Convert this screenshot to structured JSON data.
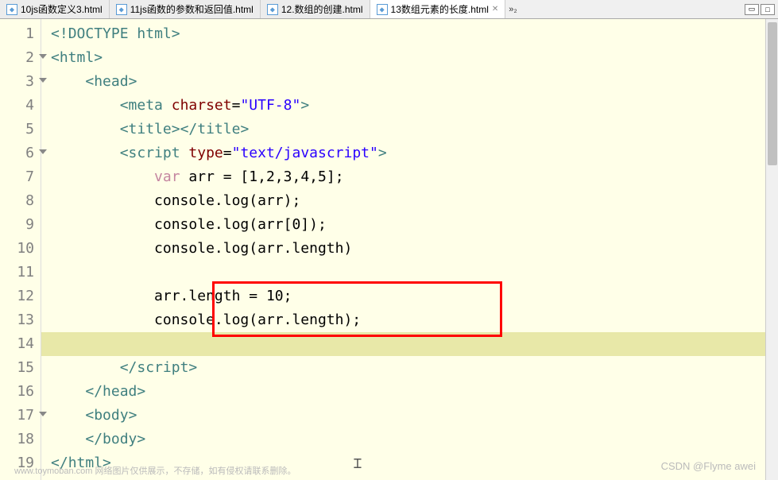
{
  "tabs": [
    {
      "label": "10js函数定义3.html",
      "active": false
    },
    {
      "label": "11js函数的参数和返回值.html",
      "active": false
    },
    {
      "label": "12.数组的创建.html",
      "active": false
    },
    {
      "label": "13数组元素的长度.html",
      "active": true
    }
  ],
  "overflow": "»₂",
  "lineNumbers": [
    "1",
    "2",
    "3",
    "4",
    "5",
    "6",
    "7",
    "8",
    "9",
    "10",
    "11",
    "12",
    "13",
    "14",
    "15",
    "16",
    "17",
    "18",
    "19"
  ],
  "foldLines": [
    2,
    3,
    6,
    17
  ],
  "code": {
    "l1": {
      "t1": "<!",
      "t2": "DOCTYPE",
      "t3": " ",
      "t4": "html",
      "t5": ">"
    },
    "l2": {
      "t1": "<",
      "t2": "html",
      "t3": ">"
    },
    "l3": {
      "pad": "    ",
      "t1": "<",
      "t2": "head",
      "t3": ">"
    },
    "l4": {
      "pad": "        ",
      "t1": "<",
      "t2": "meta",
      "t3": " ",
      "t4": "charset",
      "t5": "=",
      "t6": "\"UTF-8\"",
      "t7": ">"
    },
    "l5": {
      "pad": "        ",
      "t1": "<",
      "t2": "title",
      "t3": "></",
      "t4": "title",
      "t5": ">"
    },
    "l6": {
      "pad": "        ",
      "t1": "<",
      "t2": "script",
      "t3": " ",
      "t4": "type",
      "t5": "=",
      "t6": "\"text/javascript\"",
      "t7": ">"
    },
    "l7": {
      "pad": "            ",
      "t1": "var",
      "t2": " arr = [",
      "t3": "1",
      "t4": ",",
      "t5": "2",
      "t6": ",",
      "t7": "3",
      "t8": ",",
      "t9": "4",
      "t10": ",",
      "t11": "5",
      "t12": "];"
    },
    "l8": {
      "pad": "            ",
      "t1": "console.log(arr);"
    },
    "l9": {
      "pad": "            ",
      "t1": "console.log(arr[",
      "t2": "0",
      "t3": "]);"
    },
    "l10": {
      "pad": "            ",
      "t1": "console.log(arr.length)"
    },
    "l11": {
      "pad": ""
    },
    "l12": {
      "pad": "            ",
      "t1": "arr.length = ",
      "t2": "10",
      "t3": ";"
    },
    "l13": {
      "pad": "            ",
      "t1": "console.log(arr.length);"
    },
    "l14": {
      "pad": ""
    },
    "l15": {
      "pad": "        ",
      "t1": "</",
      "t2": "script",
      "t3": ">"
    },
    "l16": {
      "pad": "    ",
      "t1": "</",
      "t2": "head",
      "t3": ">"
    },
    "l17": {
      "pad": "    ",
      "t1": "<",
      "t2": "body",
      "t3": ">"
    },
    "l18": {
      "pad": "    ",
      "t1": "</",
      "t2": "body",
      "t3": ">"
    },
    "l19": {
      "t1": "</",
      "t2": "html",
      "t3": ">"
    }
  },
  "watermark1": "www.toymoban.com  网络图片仅供展示，不存储，如有侵权请联系删除。",
  "watermark2": "CSDN @Flyme awei"
}
